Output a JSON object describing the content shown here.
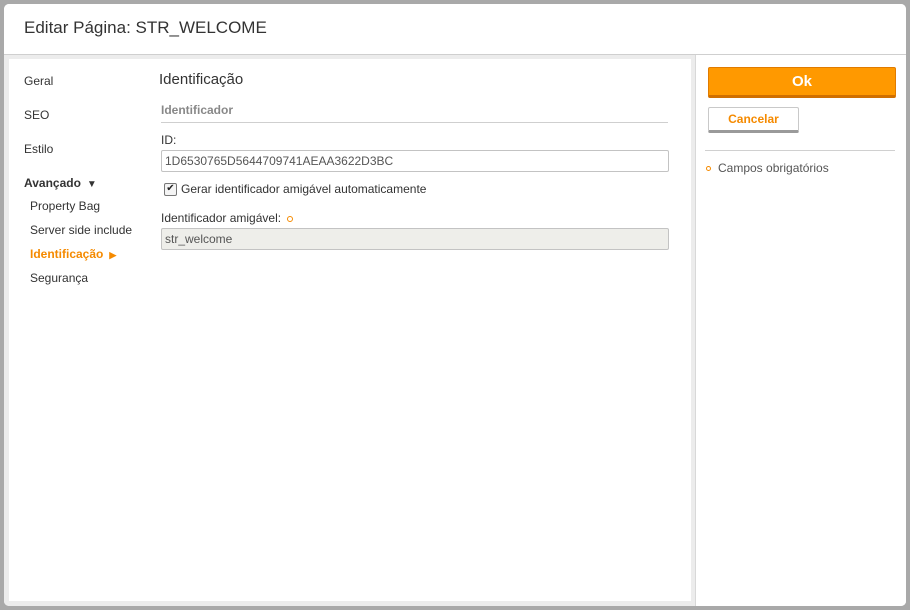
{
  "dialog": {
    "title": "Editar Página: STR_WELCOME"
  },
  "nav": {
    "items": [
      {
        "label": "Geral"
      },
      {
        "label": "SEO"
      },
      {
        "label": "Estilo"
      },
      {
        "label": "Avançado",
        "arrow": "▼"
      }
    ],
    "subitems": [
      {
        "label": "Property Bag"
      },
      {
        "label": "Server side include"
      },
      {
        "label": "Identificação",
        "arrow": "▶"
      },
      {
        "label": "Segurança"
      }
    ]
  },
  "form": {
    "section_title": "Identificação",
    "group_title": "Identificador",
    "id_label": "ID:",
    "id_value": "1D6530765D5644709741AEAA3622D3BC",
    "auto_checkbox_label": "Gerar identificador amigável automaticamente",
    "auto_checkbox_checked": true,
    "friendly_label": "Identificador amigável:",
    "friendly_value": "str_welcome"
  },
  "actions": {
    "ok_label": "Ok",
    "cancel_label": "Cancelar"
  },
  "legend": {
    "required_note": "Campos obrigatórios"
  },
  "colors": {
    "accent": "#f58a00",
    "ok_button": "#ff9900"
  },
  "icons": {
    "checkmark": "✔"
  }
}
